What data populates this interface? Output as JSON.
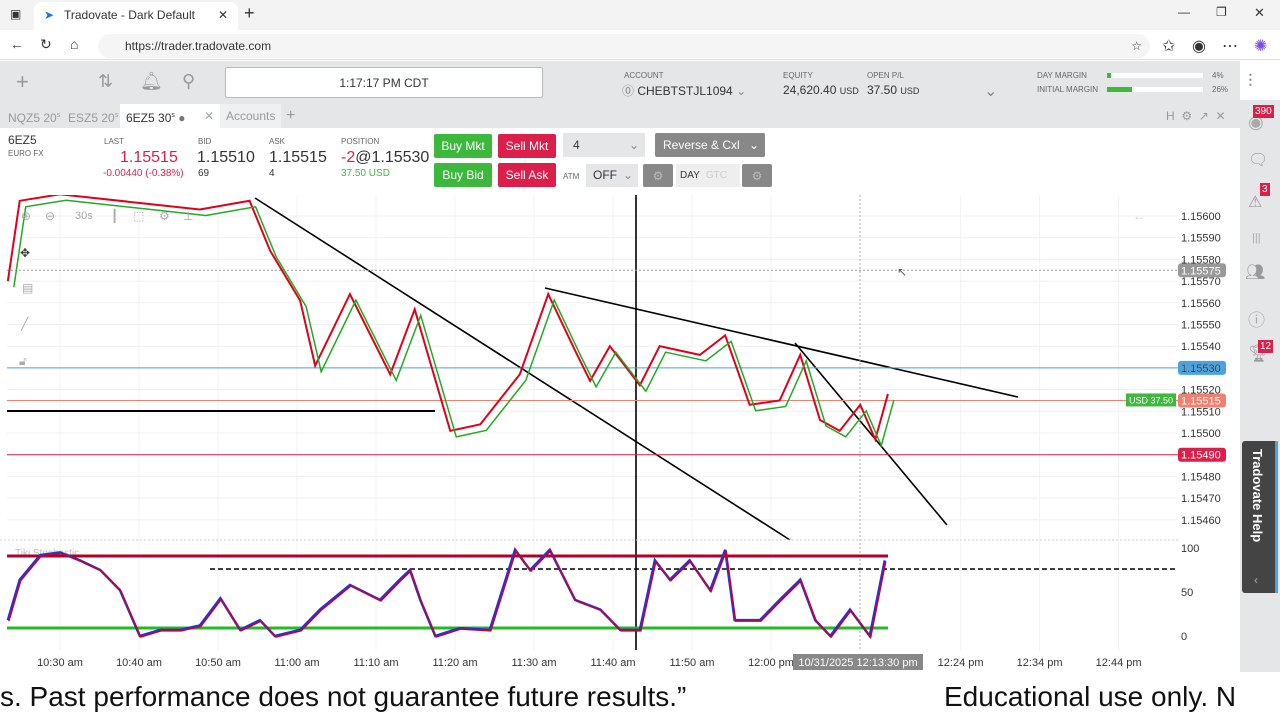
{
  "browser": {
    "tab_title": "Tradovate - Dark Default",
    "url": "https://trader.tradovate.com"
  },
  "topbar": {
    "clock": "1:17:17 PM CDT",
    "account_label": "ACCOUNT",
    "account": "CHEBTSTJL1094",
    "equity_label": "EQUITY",
    "equity": "24,620.40",
    "equity_ccy": "USD",
    "openpl_label": "OPEN P/L",
    "openpl": "37.50",
    "openpl_ccy": "USD",
    "day_margin_label": "DAY MARGIN",
    "day_margin": "4%",
    "day_margin_frac": 0.04,
    "init_margin_label": "INITIAL MARGIN",
    "init_margin": "26%",
    "init_margin_frac": 0.26
  },
  "tabs": [
    {
      "label": "NQZ5 20",
      "sup": "s"
    },
    {
      "label": "ESZ5 20",
      "sup": "s"
    },
    {
      "label": "6EZ5 30",
      "sup": "s"
    },
    {
      "label": "Accounts"
    }
  ],
  "window_icons": [
    "H",
    "⚙",
    "↗",
    "✕"
  ],
  "quote": {
    "symbol": "6EZ5",
    "name": "EURO FX",
    "last_label": "LAST",
    "last": "1.15515",
    "change": "-0.00440 (-0.38%)",
    "bid_label": "BID",
    "bid": "1.15510",
    "bid_size": "69",
    "ask_label": "ASK",
    "ask": "1.15515",
    "ask_size": "4",
    "pos_label": "POSITION",
    "pos_qty": "-2",
    "pos_price": "@1.15530",
    "pos_pl": "37.50 USD"
  },
  "orders": {
    "buy_mkt": "Buy Mkt",
    "sell_mkt": "Sell Mkt",
    "buy_bid": "Buy Bid",
    "sell_ask": "Sell Ask",
    "qty": "4",
    "reverse": "Reverse & Cxl",
    "atm_label": "ATM",
    "atm": "OFF",
    "day": "DAY",
    "gtc": "GTC"
  },
  "chart": {
    "interval": "30s",
    "indicator": "Tiki Stochastic",
    "price_ticks": [
      "1.15600",
      "1.15590",
      "1.15580",
      "1.15570",
      "1.15560",
      "1.15550",
      "1.15540",
      "1.15530",
      "1.15520",
      "1.15510",
      "1.15500",
      "1.15480",
      "1.15470",
      "1.15460"
    ],
    "markers": [
      {
        "label": "1.15575",
        "price": 1.15575,
        "color": "#999999"
      },
      {
        "label": "1.15530",
        "price": 1.1553,
        "color": "#4aa3df"
      },
      {
        "label": "1.15515",
        "price": 1.15515,
        "color": "#f08070"
      },
      {
        "label": "1.15490",
        "price": 1.1549,
        "color": "#dc1f4a"
      }
    ],
    "pl_tag": "USD 37.50",
    "stoch_ticks": [
      "100",
      "50",
      "0"
    ],
    "time_ticks": [
      "10:30 am",
      "10:40 am",
      "10:50 am",
      "11:00 am",
      "11:10 am",
      "11:20 am",
      "11:30 am",
      "11:40 am",
      "11:50 am",
      "12:00 pm",
      "12:24 pm",
      "12:34 pm",
      "12:44 pm"
    ],
    "crosshair_time": "10/31/2025 12:13:30 pm"
  },
  "chart_data": {
    "type": "line",
    "x_unit": "minutes after 10:00",
    "price": {
      "x": [
        23.4,
        24.9,
        30,
        47.7,
        54,
        56.6,
        60.4,
        62.3,
        66.7,
        71.8,
        74.9,
        79.4,
        83.2,
        88.2,
        91.8,
        95.2,
        97.1,
        99.6,
        103.4,
        105.9,
        111,
        114.2,
        117.3,
        121.1,
        123.7,
        126.2,
        128.7,
        131.3,
        133.2,
        134.8
      ],
      "y": [
        1.1557,
        1.15607,
        1.1561,
        1.15603,
        1.15607,
        1.15584,
        1.15561,
        1.15531,
        1.15564,
        1.15527,
        1.15557,
        1.15501,
        1.15504,
        1.15527,
        1.15564,
        1.15538,
        1.15524,
        1.1554,
        1.15522,
        1.1554,
        1.15536,
        1.15545,
        1.15513,
        1.15515,
        1.15536,
        1.15506,
        1.15501,
        1.15513,
        1.15497,
        1.15518
      ]
    },
    "stoch": {
      "x": [
        23.4,
        24.9,
        27.5,
        30,
        32.5,
        35.1,
        37.6,
        40.1,
        42.7,
        45.2,
        47.7,
        50.3,
        52.8,
        55.3,
        57.2,
        60.4,
        62.9,
        66.7,
        70.5,
        73,
        74.3,
        75.6,
        77.5,
        80.6,
        84.4,
        87.6,
        89.5,
        92,
        95.2,
        98.4,
        100.9,
        103.4,
        105.3,
        107.2,
        109.7,
        112.3,
        114.2,
        115.4,
        118.6,
        121.1,
        123.7,
        125.6,
        127.5,
        130,
        132.5,
        134.4
      ],
      "y": [
        18,
        64,
        92,
        95,
        86,
        75,
        52,
        0,
        7,
        7,
        12,
        43,
        7,
        18,
        0,
        7,
        30,
        58,
        41,
        64,
        75,
        41,
        0,
        9,
        7,
        98,
        75,
        98,
        41,
        30,
        7,
        7,
        86,
        64,
        86,
        52,
        98,
        18,
        18,
        41,
        64,
        18,
        0,
        30,
        0,
        86
      ]
    },
    "ylim": [
      1.1545,
      1.1561
    ]
  },
  "sidebar": {
    "badges": [
      "390",
      "3",
      "12"
    ],
    "help": "Tradovate Help"
  },
  "caption": {
    "left": "s. Past performance does not guarantee future results.”",
    "right": "Educational use only. N"
  }
}
